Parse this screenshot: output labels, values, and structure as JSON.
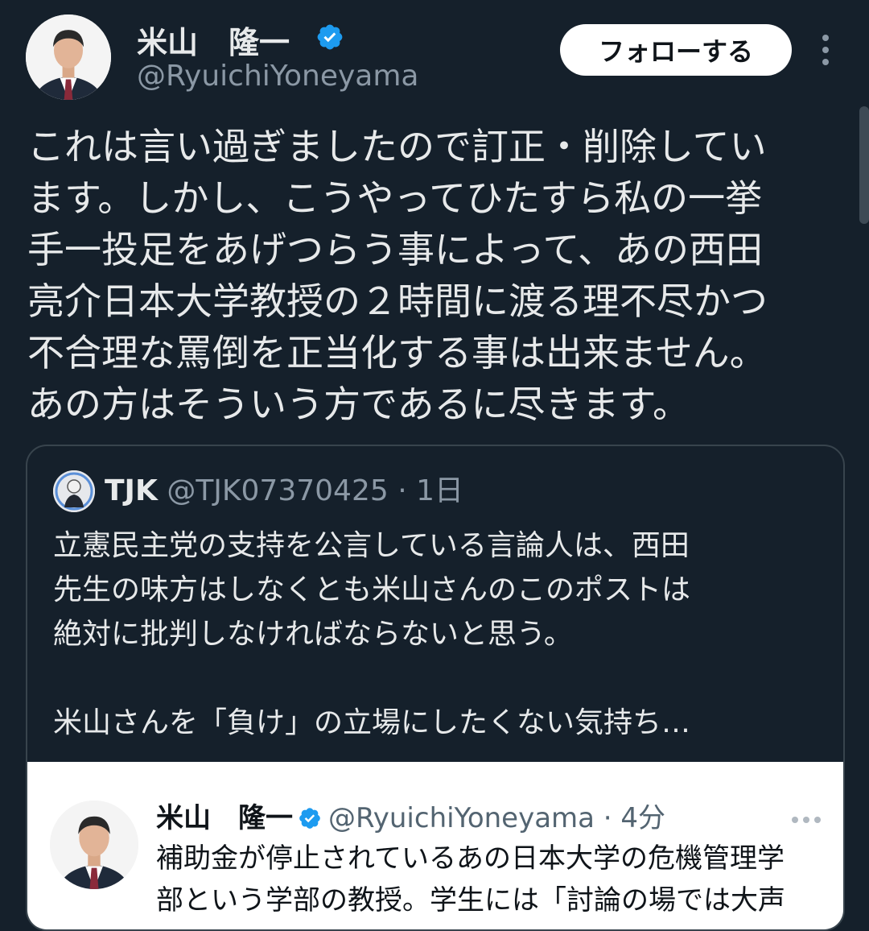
{
  "author": {
    "name": "米山　隆一",
    "handle": "@RyuichiYoneyama",
    "verified": true
  },
  "follow_button": {
    "label": "フォローする"
  },
  "tweet": {
    "lines": [
      "これは言い過ぎましたので訂正・削除してい",
      "ます。しかし、こうやってひたすら私の一挙",
      "手一投足をあげつらう事によって、あの西田",
      "亮介日本大学教授の２時間に渡る理不尽かつ",
      "不合理な罵倒を正当化する事は出来ません。",
      "あの方はそういう方であるに尽きます。"
    ]
  },
  "quote": {
    "name": "TJK",
    "handle_time": "@TJK07370425 · 1日",
    "lines": [
      "立憲民主党の支持を公言している言論人は、西田",
      "先生の味方はしなくとも米山さんのこのポストは",
      "絶対に批判しなければならないと思う。",
      "",
      "米山さんを「負け」の立場にしたくない気持ち…"
    ],
    "embedded": {
      "name": "米山　隆一",
      "handle_time": "@RyuichiYoneyama · 4分",
      "lines": [
        "補助金が停止されているあの日本大学の危機管理学",
        "部という学部の教授。学生には「討論の場では大声"
      ]
    }
  },
  "colors": {
    "background": "#15202b",
    "text": "#e7e9ea",
    "muted": "#8b98a5",
    "verified": "#1d9bf0",
    "border": "#38444d"
  },
  "icons": [
    "verified-badge-icon",
    "more-vertical-icon",
    "more-horizontal-icon"
  ]
}
